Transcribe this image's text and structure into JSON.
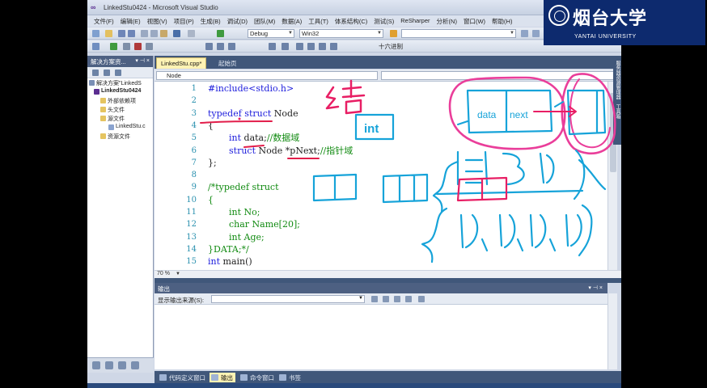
{
  "window": {
    "title": "LinkedStu0424 - Microsoft Visual Studio",
    "controls": [
      "_",
      "□",
      "✕"
    ]
  },
  "menu": [
    "文件(F)",
    "编辑(E)",
    "视图(V)",
    "项目(P)",
    "生成(B)",
    "调试(D)",
    "团队(M)",
    "数据(A)",
    "工具(T)",
    "体系结构(C)",
    "测试(S)",
    "ReSharper",
    "分析(N)",
    "窗口(W)",
    "帮助(H)"
  ],
  "toolbar": {
    "config": "Debug",
    "platform": "Win32",
    "hex_label": "十六进制"
  },
  "solution_explorer": {
    "title": "解决方案资...",
    "rows": [
      {
        "label": "解决方案\"LinkedS",
        "indent": 0
      },
      {
        "label": "LinkedStu0424",
        "indent": 1
      },
      {
        "label": "外部依赖项",
        "indent": 2
      },
      {
        "label": "头文件",
        "indent": 2
      },
      {
        "label": "源文件",
        "indent": 2
      },
      {
        "label": "LinkedStu.c",
        "indent": 3
      },
      {
        "label": "资源文件",
        "indent": 2
      }
    ]
  },
  "tabs": [
    {
      "label": "LinkedStu.cpp*",
      "active": true
    },
    {
      "label": "起始页",
      "active": false
    }
  ],
  "nav": {
    "scope": "Node"
  },
  "code": {
    "lines": [
      {
        "n": "1",
        "text": "#include<stdio.h>"
      },
      {
        "n": "2",
        "text": ""
      },
      {
        "n": "3",
        "kw": "typedef struct",
        "text": " Node"
      },
      {
        "n": "4",
        "text": "{"
      },
      {
        "n": "5",
        "kw": "int",
        "text": " data;",
        "cm": "//数据域"
      },
      {
        "n": "6",
        "kw": "struct",
        "text": " Node *pNext;",
        "cm": "//指针域"
      },
      {
        "n": "7",
        "text": "};"
      },
      {
        "n": "8",
        "text": ""
      },
      {
        "n": "9",
        "cm": "/*typedef struct"
      },
      {
        "n": "10",
        "cm": "{"
      },
      {
        "n": "11",
        "cm": "int No;"
      },
      {
        "n": "12",
        "cm": "char Name[20];"
      },
      {
        "n": "13",
        "cm": "int Age;"
      },
      {
        "n": "14",
        "cm": "}DATA;*/"
      },
      {
        "n": "15",
        "kw": "int",
        "text": " main()"
      }
    ]
  },
  "zoom": "70 %",
  "output": {
    "title": "输出",
    "source_label": "显示输出来源(S):"
  },
  "bottom_tabs": [
    "代码定义窗口",
    "输出",
    "命令窗口",
    "书签"
  ],
  "right_strip": [
    "服务器资源管理器",
    "工具箱"
  ],
  "annotations": {
    "char": "结",
    "box_int": "int",
    "node_data": "data",
    "node_next": "next"
  },
  "logo": {
    "cn": "烟台大学",
    "en": "YANTAI UNIVERSITY"
  }
}
